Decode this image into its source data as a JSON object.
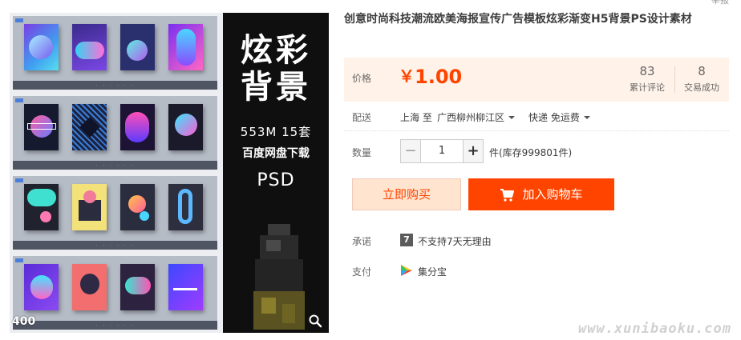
{
  "gallery": {
    "count_badge": "400",
    "banner": {
      "line1": "炫彩",
      "line2": "背景",
      "spec": "553M  15套",
      "storage": "百度网盘下载",
      "format": "PSD"
    }
  },
  "product": {
    "corner_note": "举报",
    "title": "创意时尚科技潮流欧美海报宣传广告模板炫彩渐变H5背景PS设计素材",
    "price_label": "价格",
    "currency": "￥",
    "price": "1.00",
    "reviews_count": "83",
    "reviews_label": "累计评论",
    "trades_count": "8",
    "trades_label": "交易成功"
  },
  "shipping": {
    "label": "配送",
    "origin": "上海 至",
    "destination": "广西柳州柳江区",
    "method": "快递 免运费"
  },
  "quantity": {
    "label": "数量",
    "minus": "−",
    "value": "1",
    "plus": "+",
    "stock": "件(库存999801件)"
  },
  "actions": {
    "buy_now": "立即购买",
    "add_to_cart": "加入购物车"
  },
  "promise": {
    "label": "承诺",
    "icon_text": "7",
    "text": "不支持7天无理由"
  },
  "payment": {
    "label": "支付",
    "text": "集分宝"
  },
  "watermark": "www.xunibaoku.com",
  "colors": {
    "accent": "#ff4400",
    "price_bg": "#fff2e8",
    "buy_bg": "#ffe4d0"
  }
}
